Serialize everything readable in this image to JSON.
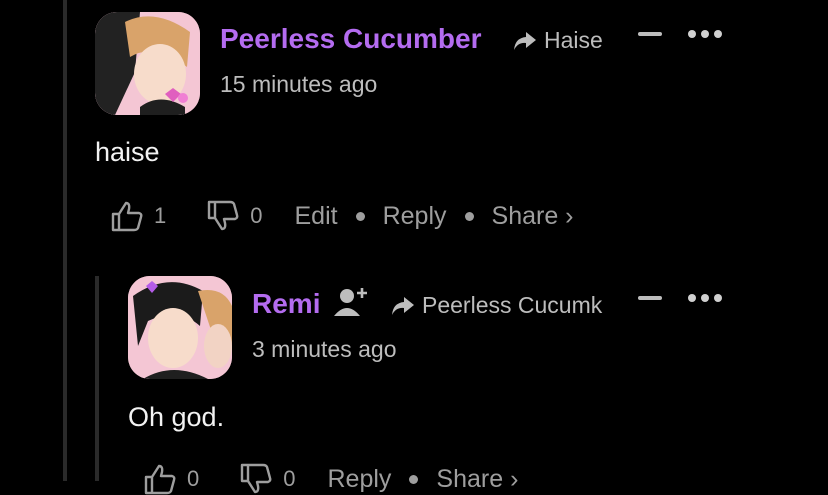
{
  "comments": [
    {
      "author": "Peerless Cucumber",
      "reply_to": "Haise",
      "time": "15 minutes ago",
      "body": "haise",
      "likes": "1",
      "dislikes": "0",
      "actions": {
        "edit": "Edit",
        "reply": "Reply",
        "share": "Share ›"
      }
    },
    {
      "author": "Remi",
      "reply_to": "Peerless Cucumk",
      "time": "3 minutes ago",
      "body": "Oh god.",
      "likes": "0",
      "dislikes": "0",
      "actions": {
        "reply": "Reply",
        "share": "Share ›"
      }
    }
  ],
  "colors": {
    "author": "#b46cf0",
    "background": "#000000",
    "muted": "#9e9e9e"
  },
  "icons": [
    "share-arrow-icon",
    "thumbs-up-icon",
    "thumbs-down-icon",
    "add-user-icon",
    "collapse-icon",
    "more-icon"
  ]
}
